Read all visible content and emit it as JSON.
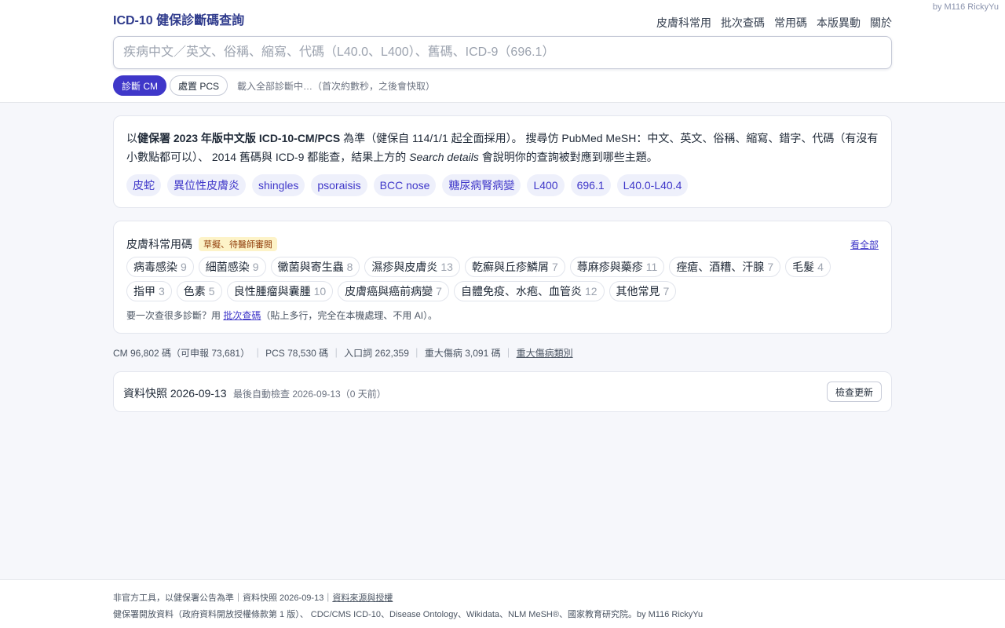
{
  "header": {
    "byline": "by M116 RickyYu",
    "title": "ICD-10 健保診斷碼查詢",
    "nav": [
      "皮膚科常用",
      "批次查碼",
      "常用碼",
      "本版異動",
      "關於"
    ]
  },
  "search": {
    "placeholder": "疾病中文／英文、俗稱、縮寫、代碼（L40.0、L400）、舊碼、ICD-9（696.1）",
    "value": ""
  },
  "modes": {
    "cm_label": "診斷 CM",
    "pcs_label": "處置 PCS",
    "active": "cm",
    "loading_text": "載入全部診斷中…（首次約數秒，之後會快取）"
  },
  "intro": {
    "pre": "以",
    "bold": "健保署 2023 年版中文版 ICD-10-CM/PCS",
    "mid": " 為準（健保自 114/1/1 起全面採用）。 搜尋仿 PubMed MeSH：中文、英文、俗稱、縮寫、錯字、代碼（有沒有小數點都可以）、 2014 舊碼與 ICD-9 都能查，結果上方的 ",
    "italic": "Search details",
    "post": " 會說明你的查詢被對應到哪些主題。",
    "examples": [
      "皮蛇",
      "異位性皮膚炎",
      "shingles",
      "psoraisis",
      "BCC nose",
      "糖尿病腎病變",
      "L400",
      "696.1",
      "L40.0-L40.4"
    ]
  },
  "derm": {
    "title": "皮膚科常用碼",
    "badge": "草擬、待醫師審閱",
    "see_all": "看全部",
    "row1": [
      {
        "name": "病毒感染",
        "count": "9"
      },
      {
        "name": "細菌感染",
        "count": "9"
      },
      {
        "name": "黴菌與寄生蟲",
        "count": "8"
      },
      {
        "name": "濕疹與皮膚炎",
        "count": "13"
      },
      {
        "name": "乾癬與丘疹鱗屑",
        "count": "7"
      },
      {
        "name": "蕁麻疹與藥疹",
        "count": "11"
      },
      {
        "name": "痤瘡、酒糟、汗腺",
        "count": "7"
      },
      {
        "name": "毛髮",
        "count": "4"
      }
    ],
    "row2": [
      {
        "name": "指甲",
        "count": "3"
      },
      {
        "name": "色素",
        "count": "5"
      },
      {
        "name": "良性腫瘤與囊腫",
        "count": "10"
      },
      {
        "name": "皮膚癌與癌前病變",
        "count": "7"
      },
      {
        "name": "自體免疫、水疱、血管炎",
        "count": "12"
      },
      {
        "name": "其他常見",
        "count": "7"
      }
    ],
    "hint_pre": "要一次查很多診斷？用 ",
    "hint_link": "批次查碼",
    "hint_post": "（貼上多行，完全在本機處理、不用 AI）。"
  },
  "stats": {
    "cm": "CM 96,802 碼（可申報 73,681）",
    "pcs": "PCS 78,530 碼",
    "entry": "入口詞 262,359",
    "major": "重大傷病 3,091 碼",
    "major_link": "重大傷病類別"
  },
  "snapshot": {
    "title": "資料快照 2026-09-13",
    "sub": "最後自動檢查 2026-09-13（0 天前）",
    "check_label": "檢查更新"
  },
  "footer": {
    "line1_pre": "非官方工具，以健保署公告為準｜資料快照 2026-09-13｜",
    "line1_link": "資料來源與授權",
    "line2": "健保署開放資料（政府資料開放授權條款第 1 版）、 CDC/CMS ICD-10、Disease Ontology、Wikidata、NLM MeSH®、國家教育研究院。by M116 RickyYu"
  },
  "colors": {
    "accent": "#3f37c9",
    "title": "#2e3a8c",
    "badge_bg": "#fdf3c8"
  }
}
